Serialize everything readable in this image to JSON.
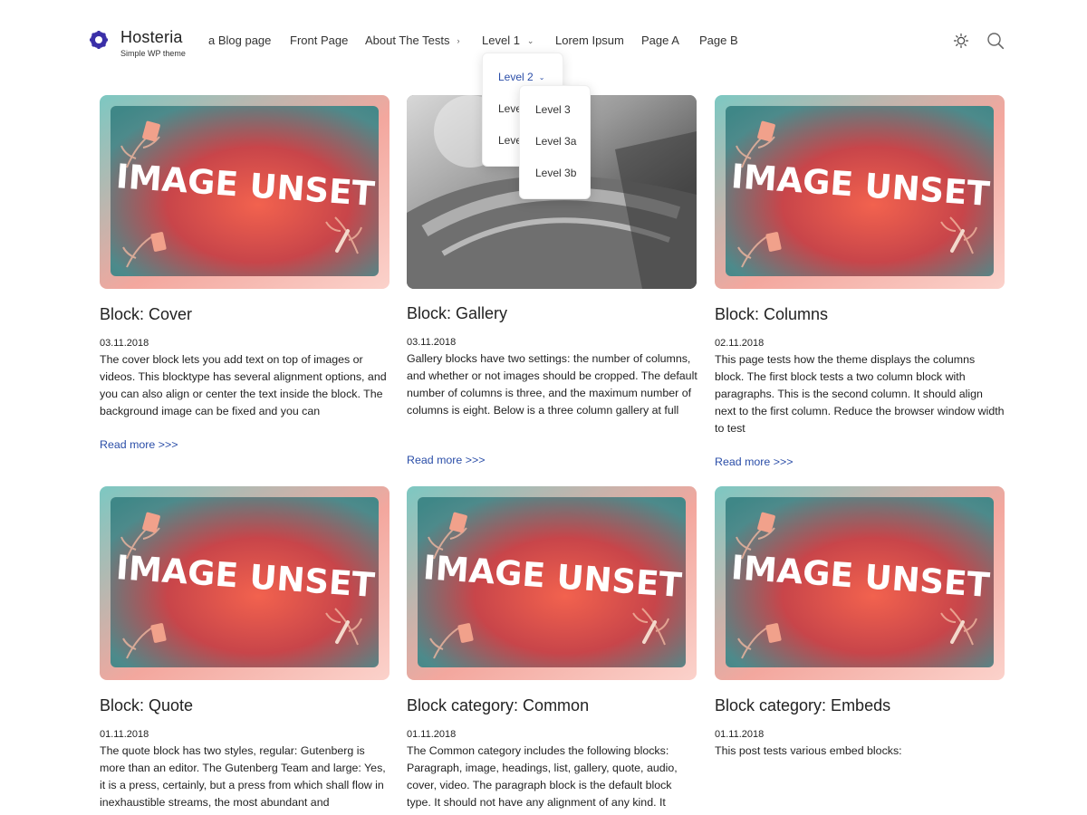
{
  "header": {
    "site_name": "Hosteria",
    "tagline": "Simple WP theme",
    "nav": [
      {
        "label": "a Blog page"
      },
      {
        "label": "Front Page"
      },
      {
        "label": "About The Tests"
      },
      {
        "label": "Level 1"
      },
      {
        "label": "Lorem Ipsum"
      },
      {
        "label": "Page A"
      },
      {
        "label": "Page B"
      }
    ],
    "icons": {
      "logo": "gear-logo-icon",
      "theme_toggle": "sun-icon",
      "search": "search-icon"
    },
    "accent_color": "#2b4ea8"
  },
  "dropdown_level1": {
    "items": [
      {
        "label": "Level 2"
      },
      {
        "label": "Leve"
      },
      {
        "label": "Leve"
      }
    ]
  },
  "dropdown_level2": {
    "items": [
      {
        "label": "Level 3"
      },
      {
        "label": "Level 3a"
      },
      {
        "label": "Level 3b"
      }
    ]
  },
  "posts": [
    {
      "title": "Block: Cover",
      "date": "03.11.2018",
      "excerpt": "The cover block lets you add text on top of images or videos. This blocktype has several alignment options, and you can also align or center the text inside the block. The background image can be fixed and you can",
      "read_more": "Read more >>>",
      "image_text": "IMAGE UNSET"
    },
    {
      "title": "Block: Gallery",
      "date": "03.11.2018",
      "excerpt": "Gallery blocks have two settings: the number of columns, and whether or not images should be cropped. The default number of columns is three, and the maximum number of columns is eight. Below is a three column gallery at full",
      "read_more": "Read more >>>"
    },
    {
      "title": "Block: Columns",
      "date": "02.11.2018",
      "excerpt": "This page tests how the theme displays the columns block. The first block tests a two column block with paragraphs. This is the second column. It should align next to the first column. Reduce the browser window width to test",
      "read_more": "Read more >>>",
      "image_text": "IMAGE UNSET"
    },
    {
      "title": "Block: Quote",
      "date": "01.11.2018",
      "excerpt": "The quote block has two styles, regular: Gutenberg is more than an editor. The Gutenberg Team and large: Yes, it is a press, certainly, but a press from which shall flow in inexhaustible streams, the most abundant and",
      "image_text": "IMAGE UNSET"
    },
    {
      "title": "Block category: Common",
      "date": "01.11.2018",
      "excerpt": "The Common category includes the following blocks: Paragraph, image, headings, list, gallery, quote, audio, cover, video. The paragraph block is the default block type.  It should not have any alignment of any kind. It",
      "image_text": "IMAGE UNSET"
    },
    {
      "title": "Block category: Embeds",
      "date": "01.11.2018",
      "excerpt": "This post tests various embed blocks:",
      "image_text": "IMAGE UNSET"
    }
  ]
}
